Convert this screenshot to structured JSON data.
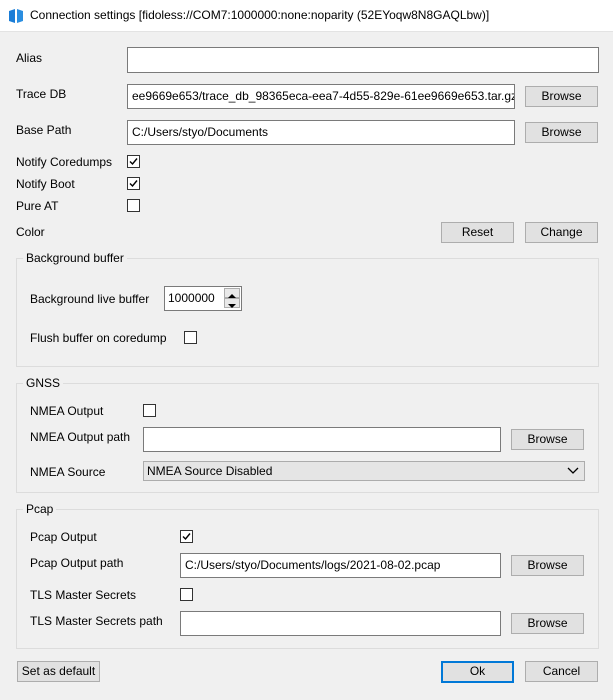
{
  "window": {
    "title": "Connection settings [fidoless://COM7:1000000:none:noparity (52EYoqw8N8GAQLbw)]",
    "icon": "app-logo-icon"
  },
  "form": {
    "alias_label": "Alias",
    "alias_value": "",
    "trace_db_label": "Trace DB",
    "trace_db_value": "ee9669e653/trace_db_98365eca-eea7-4d55-829e-61ee9669e653.tar.gz",
    "base_path_label": "Base Path",
    "base_path_value": "C:/Users/styo/Documents",
    "notify_coredumps_label": "Notify Coredumps",
    "notify_coredumps_checked": true,
    "notify_boot_label": "Notify Boot",
    "notify_boot_checked": true,
    "pure_at_label": "Pure AT",
    "pure_at_checked": false,
    "color_label": "Color",
    "browse_label": "Browse",
    "reset_label": "Reset",
    "change_label": "Change"
  },
  "background_buffer": {
    "group_title": "Background buffer",
    "live_buffer_label": "Background live buffer",
    "live_buffer_value": "1000000",
    "flush_label": "Flush buffer on coredump",
    "flush_checked": false
  },
  "gnss": {
    "group_title": "GNSS",
    "nmea_output_label": "NMEA Output",
    "nmea_output_checked": false,
    "nmea_output_path_label": "NMEA Output path",
    "nmea_output_path_value": "",
    "nmea_source_label": "NMEA Source",
    "nmea_source_value": "NMEA Source Disabled"
  },
  "pcap": {
    "group_title": "Pcap",
    "pcap_output_label": "Pcap Output",
    "pcap_output_checked": true,
    "pcap_output_path_label": "Pcap Output path",
    "pcap_output_path_value": "C:/Users/styo/Documents/logs/2021-08-02.pcap",
    "tls_label": "TLS Master Secrets",
    "tls_checked": false,
    "tls_path_label": "TLS Master Secrets path",
    "tls_path_value": ""
  },
  "footer": {
    "set_default_label": "Set as default",
    "ok_label": "Ok",
    "cancel_label": "Cancel"
  },
  "colors": {
    "accent": "#0078d7",
    "logo": "#1a7dd7"
  }
}
